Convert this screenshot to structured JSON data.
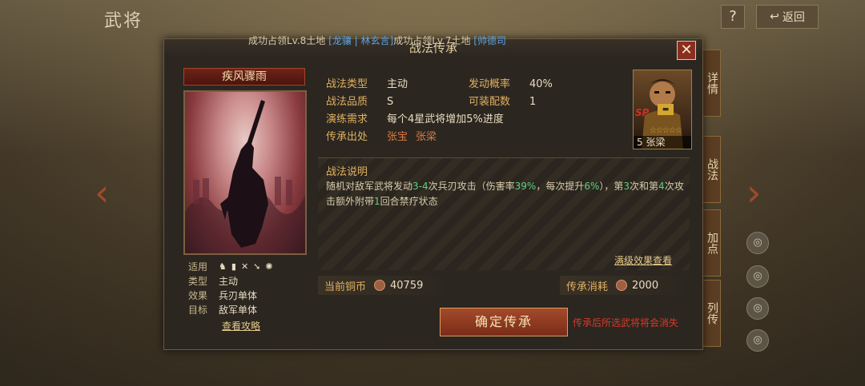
{
  "background": {
    "title": "武将",
    "help_label": "?",
    "back_label": "返回",
    "left_arrow": "‹",
    "right_arrow": "›",
    "side_tabs": [
      "详情",
      "战法",
      "加点",
      "列传"
    ],
    "side_icons": [
      "◎",
      "◎",
      "◎",
      "◎"
    ]
  },
  "marquee": {
    "text1": "成功占领Lv.8土地",
    "tag": "[龙骧 | 林玄言]",
    "text2": "成功占领Lv.7土地",
    "tag2": "[帅德司"
  },
  "dialog": {
    "title": "战法传承",
    "close_label": "✕"
  },
  "skill": {
    "name": "疾风骤雨",
    "attrs": {
      "suit_label": "适用",
      "type_label": "类型",
      "type_value": "主动",
      "effect_label": "效果",
      "effect_value": "兵刃单体",
      "target_label": "目标",
      "target_value": "敌军单体"
    },
    "guide_link": "查看攻略"
  },
  "info": {
    "type_label": "战法类型",
    "type_value": "主动",
    "prob_label": "发动概率",
    "prob_value": "40%",
    "quality_label": "战法品质",
    "quality_value": "S",
    "slots_label": "可装配数",
    "slots_value": "1",
    "req_label": "演练需求",
    "req_value": "每个4星武将增加5%进度",
    "source_label": "传承出处",
    "sources": [
      "张宝",
      "张梁"
    ]
  },
  "hero": {
    "stars": "☆☆☆☆☆",
    "caption": "5 张梁",
    "badge": "SP"
  },
  "description": {
    "title": "战法说明",
    "text_a": "随机对敌军武将发动",
    "range": "3-4",
    "text_b": "次兵刃攻击（伤害率",
    "dmg": "39%",
    "text_c": "，每次提升",
    "inc": "6%",
    "text_d": "），第",
    "n3": "3",
    "text_e": "次和第",
    "n4": "4",
    "text_f": "次攻击额外附带",
    "n1": "1",
    "text_g": "回合禁疗状态",
    "max_effect_link": "满级效果查看"
  },
  "currency": {
    "current_label": "当前铜币",
    "current_value": "40759",
    "cost_label": "传承消耗",
    "cost_value": "2000"
  },
  "actions": {
    "confirm_label": "确定传承",
    "warning": "传承后所选武将将会消失"
  }
}
